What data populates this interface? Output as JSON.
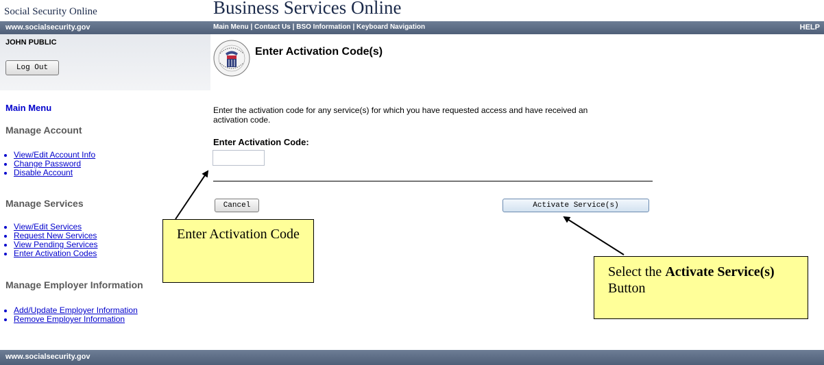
{
  "header": {
    "site_name": "Social Security Online",
    "app_title": "Business Services Online"
  },
  "top_bar": {
    "site_url": "www.socialsecurity.gov",
    "nav_main_menu": "Main Menu",
    "nav_contact_us": "Contact Us",
    "nav_bso_info": "BSO Information",
    "nav_keyboard": "Keyboard Navigation",
    "sep": "|",
    "help": "HELP"
  },
  "user": {
    "name": "JOHN PUBLIC",
    "logout_label": "Log Out"
  },
  "page": {
    "title": "Enter Activation Code(s)",
    "instructions": "Enter the activation code for any service(s) for which you have requested access and have received an activation code.",
    "field_label": "Enter Activation Code:",
    "field_value": "",
    "cancel_label": "Cancel",
    "activate_label": "Activate Service(s)"
  },
  "sidebar": {
    "main_menu": "Main Menu",
    "sections": [
      {
        "title": "Manage Account",
        "items": [
          "View/Edit Account Info",
          "Change Password",
          "Disable Account"
        ]
      },
      {
        "title": "Manage Services",
        "items": [
          "View/Edit Services",
          "Request New Services",
          "View Pending Services",
          "Enter Activation Codes"
        ]
      },
      {
        "title": "Manage Employer Information",
        "items": [
          "Add/Update Employer Information",
          "Remove Employer Information"
        ]
      }
    ]
  },
  "footer": {
    "site_url": "www.socialsecurity.gov"
  },
  "callouts": {
    "enter_code": "Enter Activation Code",
    "select_prefix": "Select the ",
    "select_bold": "Activate Service(s)",
    "select_suffix": " Button"
  },
  "colors": {
    "bar": "#5b6b84",
    "link": "#0000cc",
    "main_menu": "#0000cc",
    "callout_bg": "#ffff99"
  },
  "icons": {
    "seal": "ssa-seal-icon",
    "arrow": "arrow-icon"
  }
}
